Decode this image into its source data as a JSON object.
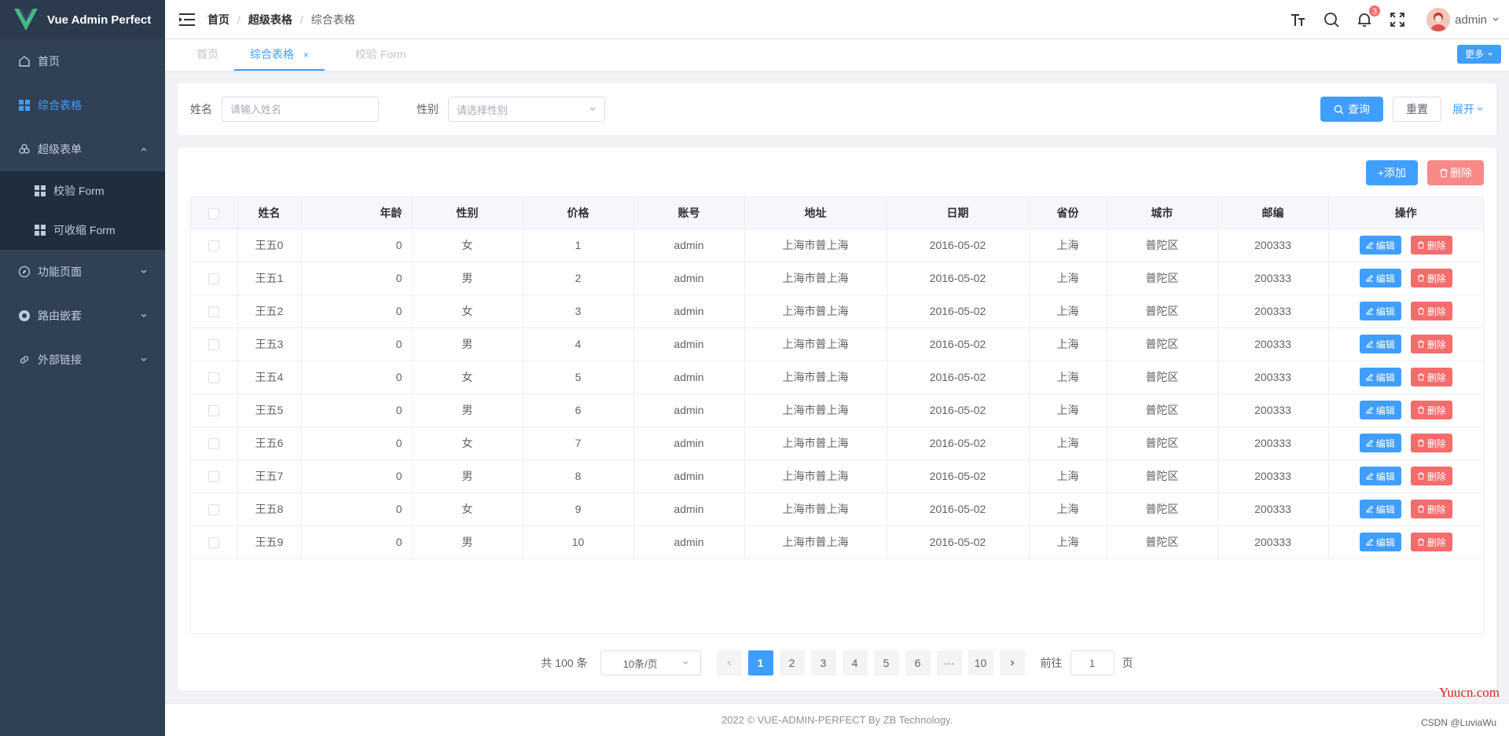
{
  "app": {
    "logo_text": "Vue Admin Perfect",
    "brand_color": "#42b883",
    "accent_color": "#409eff",
    "danger_color": "#f56c6c"
  },
  "sidebar": {
    "items": [
      {
        "label": "首页",
        "icon": "home-icon"
      },
      {
        "label": "综合表格",
        "icon": "grid-icon",
        "active": true
      },
      {
        "label": "超级表单",
        "icon": "flower-icon",
        "expanded": true
      },
      {
        "label": "校验 Form",
        "icon": "grid-icon"
      },
      {
        "label": "可收缩 Form",
        "icon": "grid-icon"
      },
      {
        "label": "功能页面",
        "icon": "compass-icon"
      },
      {
        "label": "路由嵌套",
        "icon": "chrome-icon"
      },
      {
        "label": "外部链接",
        "icon": "link-icon"
      }
    ]
  },
  "header": {
    "breadcrumb": [
      "首页",
      "超级表格",
      "综合表格"
    ],
    "notification_count": "3",
    "username": "admin"
  },
  "tabs": {
    "items": [
      {
        "label": "首页"
      },
      {
        "label": "综合表格",
        "active": true,
        "close": "×"
      },
      {
        "label": "校验 Form"
      }
    ],
    "more_label": "更多"
  },
  "search": {
    "name_label": "姓名",
    "name_placeholder": "请输入姓名",
    "gender_label": "性别",
    "gender_placeholder": "请选择性别",
    "query_label": "查询",
    "reset_label": "重置",
    "expand_label": "展开"
  },
  "toolbar": {
    "add_label": "+添加",
    "delete_label": "删除"
  },
  "table": {
    "columns": [
      "姓名",
      "年龄",
      "性别",
      "价格",
      "账号",
      "地址",
      "日期",
      "省份",
      "城市",
      "邮编",
      "操作"
    ],
    "edit_label": "编辑",
    "delete_label": "删除",
    "rows": [
      {
        "name": "王五0",
        "age": "0",
        "gender": "女",
        "price": "1",
        "account": "admin",
        "address": "上海市普上海",
        "date": "2016-05-02",
        "province": "上海",
        "city": "普陀区",
        "zip": "200333"
      },
      {
        "name": "王五1",
        "age": "0",
        "gender": "男",
        "price": "2",
        "account": "admin",
        "address": "上海市普上海",
        "date": "2016-05-02",
        "province": "上海",
        "city": "普陀区",
        "zip": "200333"
      },
      {
        "name": "王五2",
        "age": "0",
        "gender": "女",
        "price": "3",
        "account": "admin",
        "address": "上海市普上海",
        "date": "2016-05-02",
        "province": "上海",
        "city": "普陀区",
        "zip": "200333"
      },
      {
        "name": "王五3",
        "age": "0",
        "gender": "男",
        "price": "4",
        "account": "admin",
        "address": "上海市普上海",
        "date": "2016-05-02",
        "province": "上海",
        "city": "普陀区",
        "zip": "200333"
      },
      {
        "name": "王五4",
        "age": "0",
        "gender": "女",
        "price": "5",
        "account": "admin",
        "address": "上海市普上海",
        "date": "2016-05-02",
        "province": "上海",
        "city": "普陀区",
        "zip": "200333"
      },
      {
        "name": "王五5",
        "age": "0",
        "gender": "男",
        "price": "6",
        "account": "admin",
        "address": "上海市普上海",
        "date": "2016-05-02",
        "province": "上海",
        "city": "普陀区",
        "zip": "200333"
      },
      {
        "name": "王五6",
        "age": "0",
        "gender": "女",
        "price": "7",
        "account": "admin",
        "address": "上海市普上海",
        "date": "2016-05-02",
        "province": "上海",
        "city": "普陀区",
        "zip": "200333"
      },
      {
        "name": "王五7",
        "age": "0",
        "gender": "男",
        "price": "8",
        "account": "admin",
        "address": "上海市普上海",
        "date": "2016-05-02",
        "province": "上海",
        "city": "普陀区",
        "zip": "200333"
      },
      {
        "name": "王五8",
        "age": "0",
        "gender": "女",
        "price": "9",
        "account": "admin",
        "address": "上海市普上海",
        "date": "2016-05-02",
        "province": "上海",
        "city": "普陀区",
        "zip": "200333"
      },
      {
        "name": "王五9",
        "age": "0",
        "gender": "男",
        "price": "10",
        "account": "admin",
        "address": "上海市普上海",
        "date": "2016-05-02",
        "province": "上海",
        "city": "普陀区",
        "zip": "200333"
      }
    ]
  },
  "pagination": {
    "total_label": "共 100 条",
    "page_size": "10条/页",
    "pages": [
      "1",
      "2",
      "3",
      "4",
      "5",
      "6",
      "···",
      "10"
    ],
    "current_page": "1",
    "goto_label": "前往",
    "goto_value": "1",
    "page_suffix": "页"
  },
  "footer": {
    "text": "2022 © VUE-ADMIN-PERFECT By ZB Technology."
  },
  "watermarks": {
    "site": "Yuucn.com",
    "csdn": "CSDN @LuviaWu"
  }
}
